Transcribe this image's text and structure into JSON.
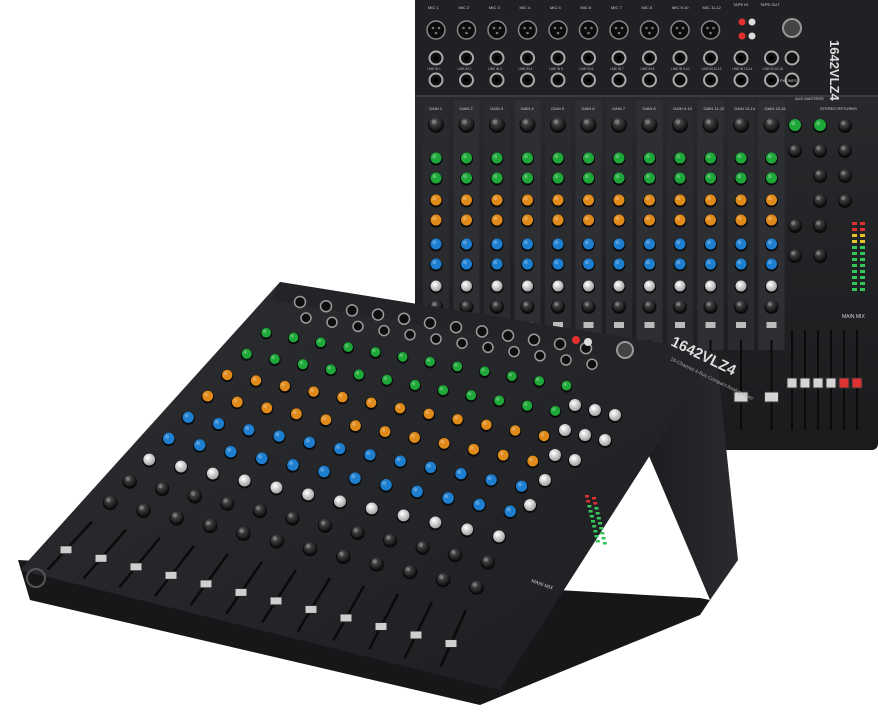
{
  "product": {
    "model": "1642VLZ4",
    "subtitle": "16-Channel 4-Bus Compact Analog Mixer"
  },
  "rear_mixer": {
    "input_labels": [
      "MIC 1",
      "MIC 2",
      "MIC 3",
      "MIC 4",
      "MIC 5",
      "MIC 6",
      "MIC 7",
      "MIC 8",
      "MIC 9-10",
      "MIC 11-12"
    ],
    "line_labels": [
      "LINE IN 1",
      "LINE IN 2",
      "LINE IN 3",
      "LINE IN 4",
      "LINE IN 5",
      "LINE IN 6",
      "LINE IN 7",
      "LINE IN 8",
      "LINE IN 9-10",
      "LINE IN 11-12",
      "LINE IN 13-14",
      "LINE IN 15-16"
    ],
    "gain_label": "GAIN",
    "channel_numbers": [
      "1",
      "2",
      "3",
      "4",
      "5",
      "6",
      "7",
      "8",
      "9-10",
      "11-12",
      "13-14",
      "15-16"
    ],
    "tape_labels": [
      "TAPE IN",
      "TAPE OUT"
    ],
    "phones_label": "PHONES",
    "aux_masters_label": "AUX MASTERS",
    "stereo_returns_label": "STEREO RETURNS",
    "main_mix_label": "MAIN MIX"
  },
  "front_mixer": {
    "main_mix_label": "MAIN MIX"
  },
  "colors": {
    "body": "#1b1c1e",
    "panel": "#2a2c2f",
    "eq_high": "#1fa83a",
    "eq_mid": "#e08a1a",
    "eq_low": "#1e7fd0",
    "knob_white": "#e8e8e8",
    "meter_green": "#34c759",
    "meter_red": "#e03030"
  }
}
